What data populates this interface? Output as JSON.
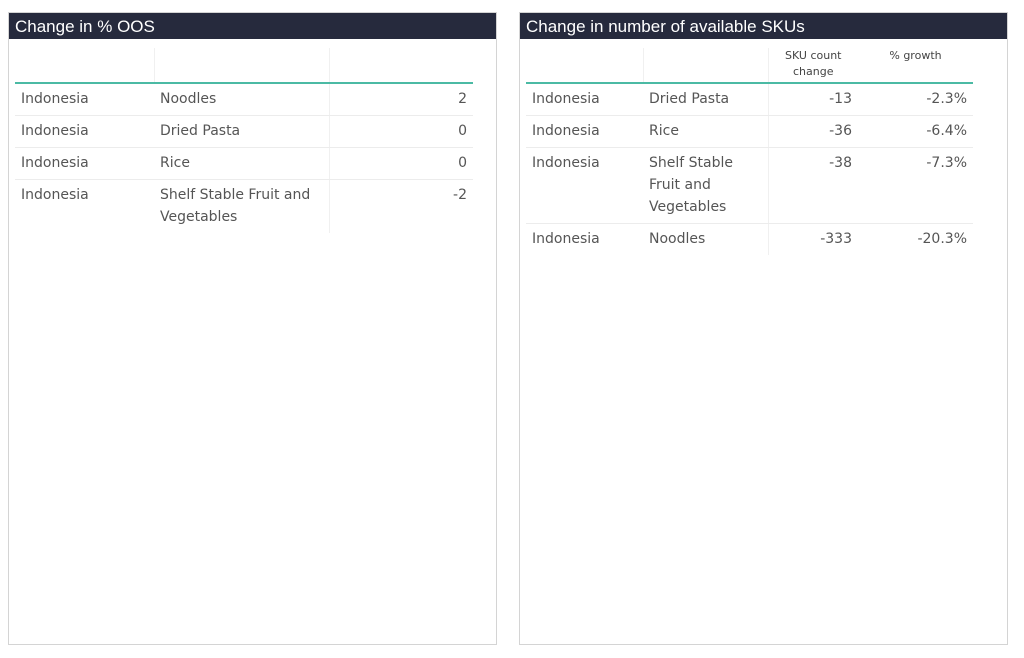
{
  "oos_panel": {
    "title": "Change in % OOS",
    "rows": [
      {
        "country": "Indonesia",
        "category": "Noodles",
        "value": "2"
      },
      {
        "country": "Indonesia",
        "category": "Dried Pasta",
        "value": "0"
      },
      {
        "country": "Indonesia",
        "category": "Rice",
        "value": "0"
      },
      {
        "country": "Indonesia",
        "category": "Shelf Stable Fruit and Vegetables",
        "value": "-2"
      }
    ]
  },
  "sku_panel": {
    "title": "Change in number of available SKUs",
    "headers": {
      "sku_count_change": "SKU count change",
      "pct_growth": "% growth"
    },
    "rows": [
      {
        "country": "Indonesia",
        "category": "Dried Pasta",
        "sku_change": "-13",
        "growth": "-2.3%"
      },
      {
        "country": "Indonesia",
        "category": "Rice",
        "sku_change": "-36",
        "growth": "-6.4%"
      },
      {
        "country": "Indonesia",
        "category": "Shelf Stable Fruit and Vegetables",
        "sku_change": "-38",
        "growth": "-7.3%"
      },
      {
        "country": "Indonesia",
        "category": "Noodles",
        "sku_change": "-333",
        "growth": "-20.3%"
      }
    ]
  },
  "colors": {
    "title_bar": "#262a3d",
    "header_underline": "#4bbaa4"
  }
}
